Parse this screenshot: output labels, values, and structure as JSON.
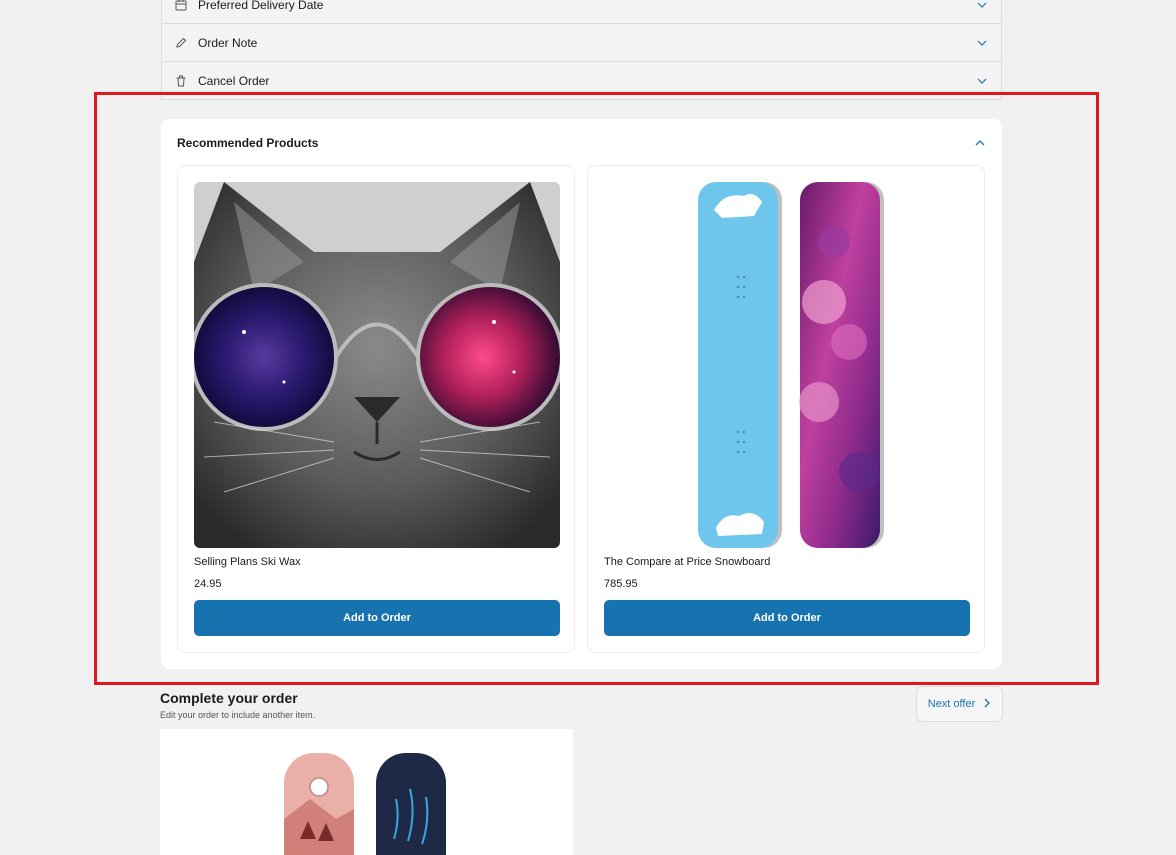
{
  "accordion": [
    {
      "label": "Preferred Delivery Date",
      "icon": "calendar-icon"
    },
    {
      "label": "Order Note",
      "icon": "pencil-icon"
    },
    {
      "label": "Cancel Order",
      "icon": "trash-icon"
    }
  ],
  "recommended": {
    "title": "Recommended Products",
    "products": [
      {
        "name": "Selling Plans Ski Wax",
        "price": "24.95",
        "button": "Add to Order",
        "image": "cat-with-galaxy-sunglasses"
      },
      {
        "name": "The Compare at Price Snowboard",
        "price": "785.95",
        "button": "Add to Order",
        "image": "blue-and-purple-snowboards"
      }
    ]
  },
  "complete_order": {
    "title": "Complete your order",
    "subtitle": "Edit your order to include another item.",
    "next_offer_label": "Next offer",
    "image": "pink-and-navy-snowboards"
  },
  "colors": {
    "accent": "#1773b0",
    "highlight": "#e0181e",
    "background": "#f1f1f1"
  }
}
